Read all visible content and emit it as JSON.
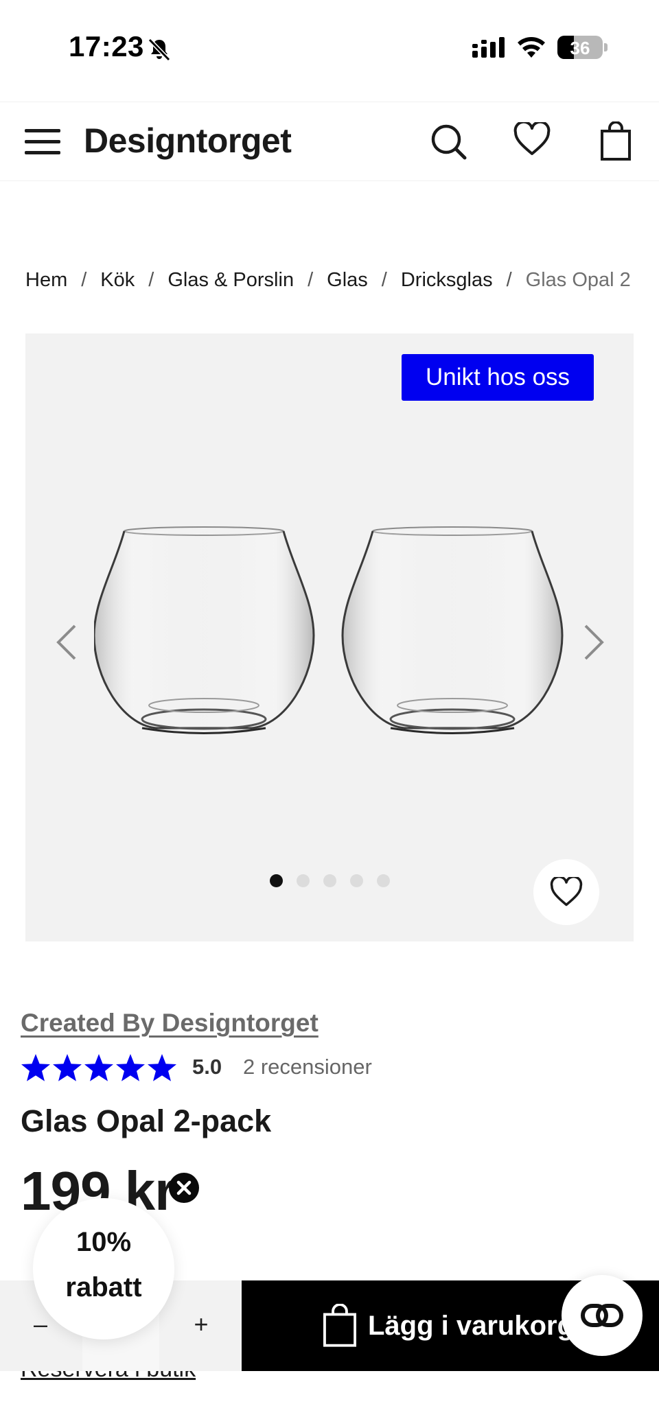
{
  "status_bar": {
    "time": "17:23",
    "battery": "36"
  },
  "header": {
    "logo": "Designtorget"
  },
  "breadcrumb": {
    "items": [
      "Hem",
      "Kök",
      "Glas & Porslin",
      "Glas",
      "Dricksglas"
    ],
    "current": "Glas Opal 2",
    "separator": "/"
  },
  "gallery": {
    "badge": "Unikt hos oss",
    "slide_count": 5,
    "active_slide": 1
  },
  "product": {
    "brand": "Created By Designtorget",
    "rating_stars": 5,
    "rating": "5.0",
    "reviews": "2 recensioner",
    "title": "Glas Opal 2-pack",
    "price": "199 kr",
    "reserve_link": "Reservera i butik"
  },
  "discount_popup": {
    "line1": "10%",
    "line2": "rabatt"
  },
  "bottom_bar": {
    "minus": "–",
    "quantity": "",
    "plus": "+",
    "add_to_cart": "Lägg i varukorgen"
  },
  "colors": {
    "badge_blue": "#0000f0",
    "star_blue": "#0000f0",
    "cart_button": "#000000"
  }
}
